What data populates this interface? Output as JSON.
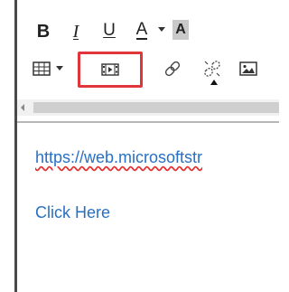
{
  "toolbar": {
    "bold_label": "B",
    "italic_label": "I",
    "underline_label": "U",
    "font_color_label": "A",
    "bg_color_label": "A",
    "icons": {
      "table": "table-icon",
      "video": "video-icon",
      "link": "link-icon",
      "unlink": "unlink-icon",
      "image": "image-icon",
      "dropdown": "chevron-down-icon"
    },
    "highlight_color": "#e0353b"
  },
  "content": {
    "url_text": "https://web.microsoftstr",
    "link_text": "Click Here",
    "link_color": "#2870c4",
    "spellcheck_color": "#e53333"
  }
}
